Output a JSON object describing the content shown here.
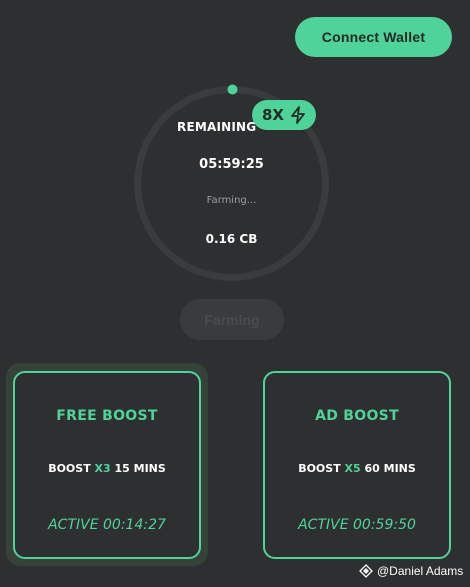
{
  "header": {
    "connect_label": "Connect Wallet"
  },
  "farming": {
    "remaining_label": "REMAINING TIME",
    "time": "05:59:25",
    "status": "Farming...",
    "amount": "0.16 CB",
    "multiplier": "8X",
    "button_label": "Farming"
  },
  "boosts": [
    {
      "title": "FREE BOOST",
      "prefix": "BOOST ",
      "multiplier": "X3",
      "duration": " 15 MINS",
      "active": "ACTIVE 00:14:27"
    },
    {
      "title": "AD BOOST",
      "prefix": "BOOST ",
      "multiplier": "X5",
      "duration": " 60 MINS",
      "active": "ACTIVE 00:59:50"
    }
  ],
  "watermark": {
    "text": "@Daniel Adams"
  },
  "colors": {
    "accent": "#4fd39b",
    "background": "#2e2f30"
  },
  "icons": {
    "multiplier": "lightning-bolt-icon",
    "watermark": "sparkle-diamond-icon"
  }
}
